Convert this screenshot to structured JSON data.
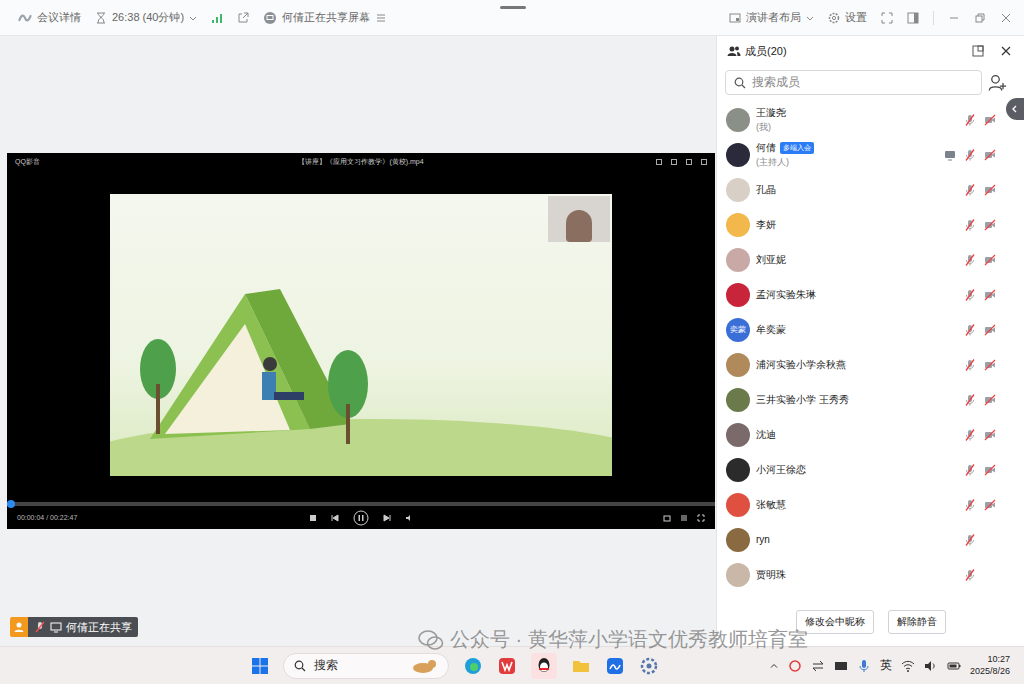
{
  "topbar": {
    "meeting_details": "会议详情",
    "timer": "26:38 (40分钟)",
    "sharing_notice": "何倩正在共享屏幕",
    "layout": "演讲者布局",
    "settings": "设置"
  },
  "player": {
    "app": "QQ影音",
    "file": "【讲座】《应用文习作教学》(黄校).mp4",
    "time": "00:00:04 / 00:22:47",
    "level": 0.006,
    "playing": true
  },
  "share_badge": {
    "label": "何倩正在共享"
  },
  "members_panel": {
    "title": "成员(20)",
    "search_placeholder": "搜索成员",
    "members": [
      {
        "name": "王漩尧",
        "role": "(我)",
        "tag": "",
        "avatar_text": "",
        "color": "#8a8f88",
        "sharing": false,
        "mic_muted": true,
        "show_camera": true,
        "camera_off": true
      },
      {
        "name": "何倩",
        "role": "(主持人)",
        "tag": "多端入会",
        "avatar_text": "",
        "color": "#2a2a3a",
        "sharing": true,
        "mic_muted": true,
        "show_camera": true,
        "camera_off": true
      },
      {
        "name": "孔晶",
        "role": "",
        "tag": "",
        "avatar_text": "",
        "color": "#d8cfc6",
        "sharing": false,
        "mic_muted": true,
        "show_camera": true,
        "camera_off": true
      },
      {
        "name": "李妍",
        "role": "",
        "tag": "",
        "avatar_text": "",
        "color": "#f2b84b",
        "sharing": false,
        "mic_muted": true,
        "show_camera": true,
        "camera_off": true
      },
      {
        "name": "刘亚妮",
        "role": "",
        "tag": "",
        "avatar_text": "",
        "color": "#c9a9a6",
        "sharing": false,
        "mic_muted": true,
        "show_camera": true,
        "camera_off": true
      },
      {
        "name": "孟河实验朱琳",
        "role": "",
        "tag": "",
        "avatar_text": "",
        "color": "#c8243a",
        "sharing": false,
        "mic_muted": true,
        "show_camera": true,
        "camera_off": true
      },
      {
        "name": "牟奕蒙",
        "role": "",
        "tag": "",
        "avatar_text": "奕蒙",
        "color": "#3b6fd8",
        "sharing": false,
        "mic_muted": true,
        "show_camera": true,
        "camera_off": true
      },
      {
        "name": "浦河实验小学余秋燕",
        "role": "",
        "tag": "",
        "avatar_text": "",
        "color": "#b08a5a",
        "sharing": false,
        "mic_muted": true,
        "show_camera": true,
        "camera_off": true
      },
      {
        "name": "三井实验小学 王秀秀",
        "role": "",
        "tag": "",
        "avatar_text": "",
        "color": "#6b7a4a",
        "sharing": false,
        "mic_muted": true,
        "show_camera": true,
        "camera_off": true
      },
      {
        "name": "沈迪",
        "role": "",
        "tag": "",
        "avatar_text": "",
        "color": "#7a6a6a",
        "sharing": false,
        "mic_muted": true,
        "show_camera": true,
        "camera_off": true
      },
      {
        "name": "小河王徐恋",
        "role": "",
        "tag": "",
        "avatar_text": "",
        "color": "#2b2b2b",
        "sharing": false,
        "mic_muted": true,
        "show_camera": true,
        "camera_off": true
      },
      {
        "name": "张敏慧",
        "role": "",
        "tag": "",
        "avatar_text": "",
        "color": "#e05040",
        "sharing": false,
        "mic_muted": true,
        "show_camera": true,
        "camera_off": true
      },
      {
        "name": "ryn",
        "role": "",
        "tag": "",
        "avatar_text": "",
        "color": "#8a6a40",
        "sharing": false,
        "mic_muted": true,
        "show_camera": false,
        "camera_off": true
      },
      {
        "name": "贾明珠",
        "role": "",
        "tag": "",
        "avatar_text": "",
        "color": "#c9b8a8",
        "sharing": false,
        "mic_muted": true,
        "show_camera": false,
        "camera_off": true
      }
    ],
    "buttons": [
      "修改会中昵称",
      "解除静音"
    ]
  },
  "watermark": "公众号 · 黄华萍小学语文优秀教师培育室",
  "taskbar": {
    "search": "搜索",
    "input_method": "英",
    "time": "10:27",
    "date": "2025/8/26"
  }
}
